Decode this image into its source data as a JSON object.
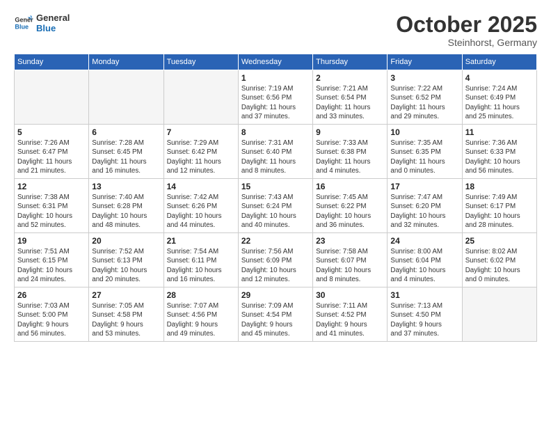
{
  "header": {
    "logo_line1": "General",
    "logo_line2": "Blue",
    "month": "October 2025",
    "location": "Steinhorst, Germany"
  },
  "weekdays": [
    "Sunday",
    "Monday",
    "Tuesday",
    "Wednesday",
    "Thursday",
    "Friday",
    "Saturday"
  ],
  "weeks": [
    [
      {
        "day": "",
        "info": ""
      },
      {
        "day": "",
        "info": ""
      },
      {
        "day": "",
        "info": ""
      },
      {
        "day": "1",
        "info": "Sunrise: 7:19 AM\nSunset: 6:56 PM\nDaylight: 11 hours\nand 37 minutes."
      },
      {
        "day": "2",
        "info": "Sunrise: 7:21 AM\nSunset: 6:54 PM\nDaylight: 11 hours\nand 33 minutes."
      },
      {
        "day": "3",
        "info": "Sunrise: 7:22 AM\nSunset: 6:52 PM\nDaylight: 11 hours\nand 29 minutes."
      },
      {
        "day": "4",
        "info": "Sunrise: 7:24 AM\nSunset: 6:49 PM\nDaylight: 11 hours\nand 25 minutes."
      }
    ],
    [
      {
        "day": "5",
        "info": "Sunrise: 7:26 AM\nSunset: 6:47 PM\nDaylight: 11 hours\nand 21 minutes."
      },
      {
        "day": "6",
        "info": "Sunrise: 7:28 AM\nSunset: 6:45 PM\nDaylight: 11 hours\nand 16 minutes."
      },
      {
        "day": "7",
        "info": "Sunrise: 7:29 AM\nSunset: 6:42 PM\nDaylight: 11 hours\nand 12 minutes."
      },
      {
        "day": "8",
        "info": "Sunrise: 7:31 AM\nSunset: 6:40 PM\nDaylight: 11 hours\nand 8 minutes."
      },
      {
        "day": "9",
        "info": "Sunrise: 7:33 AM\nSunset: 6:38 PM\nDaylight: 11 hours\nand 4 minutes."
      },
      {
        "day": "10",
        "info": "Sunrise: 7:35 AM\nSunset: 6:35 PM\nDaylight: 11 hours\nand 0 minutes."
      },
      {
        "day": "11",
        "info": "Sunrise: 7:36 AM\nSunset: 6:33 PM\nDaylight: 10 hours\nand 56 minutes."
      }
    ],
    [
      {
        "day": "12",
        "info": "Sunrise: 7:38 AM\nSunset: 6:31 PM\nDaylight: 10 hours\nand 52 minutes."
      },
      {
        "day": "13",
        "info": "Sunrise: 7:40 AM\nSunset: 6:28 PM\nDaylight: 10 hours\nand 48 minutes."
      },
      {
        "day": "14",
        "info": "Sunrise: 7:42 AM\nSunset: 6:26 PM\nDaylight: 10 hours\nand 44 minutes."
      },
      {
        "day": "15",
        "info": "Sunrise: 7:43 AM\nSunset: 6:24 PM\nDaylight: 10 hours\nand 40 minutes."
      },
      {
        "day": "16",
        "info": "Sunrise: 7:45 AM\nSunset: 6:22 PM\nDaylight: 10 hours\nand 36 minutes."
      },
      {
        "day": "17",
        "info": "Sunrise: 7:47 AM\nSunset: 6:20 PM\nDaylight: 10 hours\nand 32 minutes."
      },
      {
        "day": "18",
        "info": "Sunrise: 7:49 AM\nSunset: 6:17 PM\nDaylight: 10 hours\nand 28 minutes."
      }
    ],
    [
      {
        "day": "19",
        "info": "Sunrise: 7:51 AM\nSunset: 6:15 PM\nDaylight: 10 hours\nand 24 minutes."
      },
      {
        "day": "20",
        "info": "Sunrise: 7:52 AM\nSunset: 6:13 PM\nDaylight: 10 hours\nand 20 minutes."
      },
      {
        "day": "21",
        "info": "Sunrise: 7:54 AM\nSunset: 6:11 PM\nDaylight: 10 hours\nand 16 minutes."
      },
      {
        "day": "22",
        "info": "Sunrise: 7:56 AM\nSunset: 6:09 PM\nDaylight: 10 hours\nand 12 minutes."
      },
      {
        "day": "23",
        "info": "Sunrise: 7:58 AM\nSunset: 6:07 PM\nDaylight: 10 hours\nand 8 minutes."
      },
      {
        "day": "24",
        "info": "Sunrise: 8:00 AM\nSunset: 6:04 PM\nDaylight: 10 hours\nand 4 minutes."
      },
      {
        "day": "25",
        "info": "Sunrise: 8:02 AM\nSunset: 6:02 PM\nDaylight: 10 hours\nand 0 minutes."
      }
    ],
    [
      {
        "day": "26",
        "info": "Sunrise: 7:03 AM\nSunset: 5:00 PM\nDaylight: 9 hours\nand 56 minutes."
      },
      {
        "day": "27",
        "info": "Sunrise: 7:05 AM\nSunset: 4:58 PM\nDaylight: 9 hours\nand 53 minutes."
      },
      {
        "day": "28",
        "info": "Sunrise: 7:07 AM\nSunset: 4:56 PM\nDaylight: 9 hours\nand 49 minutes."
      },
      {
        "day": "29",
        "info": "Sunrise: 7:09 AM\nSunset: 4:54 PM\nDaylight: 9 hours\nand 45 minutes."
      },
      {
        "day": "30",
        "info": "Sunrise: 7:11 AM\nSunset: 4:52 PM\nDaylight: 9 hours\nand 41 minutes."
      },
      {
        "day": "31",
        "info": "Sunrise: 7:13 AM\nSunset: 4:50 PM\nDaylight: 9 hours\nand 37 minutes."
      },
      {
        "day": "",
        "info": ""
      }
    ]
  ]
}
